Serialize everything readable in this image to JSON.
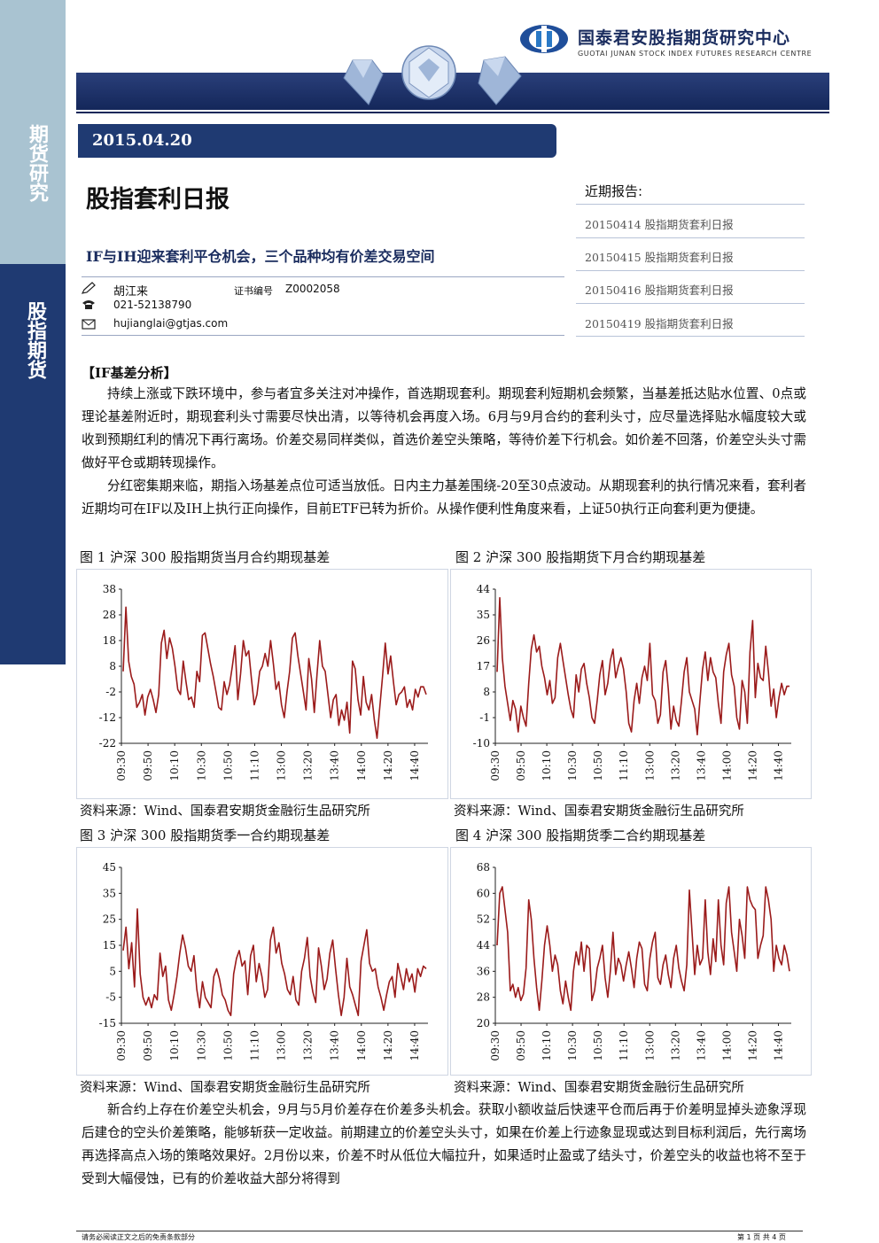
{
  "sidebar": {
    "label_1": "期货研究",
    "label_2": "股指期货"
  },
  "header": {
    "company_cn": "国泰君安股指期货研究中心",
    "company_en": "GUOTAI JUNAN STOCK INDEX FUTURES RESEARCH CENTRE"
  },
  "date": "2015.04.20",
  "report_title": "股指套利日报",
  "headline": "IF与IH迎来套利平仓机会，三个品种均有价差交易空间",
  "author": {
    "name": "胡江来",
    "license_label": "证书编号",
    "license_no": "Z0002058",
    "phone": "021-52138790",
    "email": "hujianglai@gtjas.com"
  },
  "recent": {
    "title": "近期报告:",
    "items": [
      "20150414 股指期货套利日报",
      "20150415 股指期货套利日报",
      "20150416 股指期货套利日报",
      "20150419 股指期货套利日报"
    ]
  },
  "section_title": "【IF基差分析】",
  "paragraphs": [
    "持续上涨或下跌环境中，参与者宜多关注对冲操作，首选期现套利。期现套利短期机会频繁，当基差抵达贴水位置、0点或理论基差附近时，期现套利头寸需要尽快出清，以等待机会再度入场。6月与9月合约的套利头寸，应尽量选择贴水幅度较大或收到预期红利的情况下再行离场。价差交易同样类似，首选价差空头策略，等待价差下行机会。如价差不回落，价差空头头寸需做好平仓或期转现操作。",
    "分红密集期来临，期指入场基差点位可适当放低。日内主力基差围绕-20至30点波动。从期现套利的执行情况来看，套利者近期均可在IF以及IH上执行正向操作，目前ETF已转为折价。从操作便利性角度来看，上证50执行正向套利更为便捷。",
    "新合约上存在价差空头机会，9月与5月价差存在价差多头机会。获取小额收益后快速平仓而后再于价差明显掉头迹象浮现后建仓的空头价差策略，能够斩获一定收益。前期建立的价差空头头寸，如果在价差上行迹象显现或达到目标利润后，先行离场再选择高点入场的策略效果好。2月份以来，价差不时从低位大幅拉升，如果适时止盈或了结头寸，价差空头的收益也将不至于受到大幅侵蚀，已有的价差收益大部分将得到"
  ],
  "source_text": "资料来源：Wind、国泰君安期货金融衍生品研究所",
  "footer": {
    "left": "请务必阅读正文之后的免责条款部分",
    "right": "第 1 页 共 4 页"
  },
  "colors": {
    "navy": "#1f3a72",
    "line": "#9b1b1b",
    "sidebar_light": "#a9c3d1"
  },
  "chart_data": [
    {
      "type": "line",
      "title": "图 1 沪深 300 股指期货当月合约期现基差",
      "yticks": [
        38,
        28,
        18,
        8,
        -2,
        -12,
        -22
      ],
      "ylim": [
        -22,
        38
      ],
      "x_ticks": [
        "09:30",
        "09:50",
        "10:10",
        "10:30",
        "10:50",
        "11:10",
        "13:00",
        "13:20",
        "13:40",
        "14:00",
        "14:20",
        "14:40"
      ],
      "series": [
        {
          "values": [
            6,
            31,
            10,
            4,
            1,
            -8,
            -6,
            -3,
            -11,
            -4,
            -1,
            -5,
            -10,
            -3,
            17,
            22,
            11,
            19,
            15,
            8,
            -1,
            -3,
            10,
            2,
            -5,
            -4,
            -8,
            6,
            2,
            20,
            21,
            15,
            9,
            4,
            -2,
            -8,
            -9,
            2,
            -3,
            1,
            8,
            16,
            -5,
            5,
            18,
            12,
            14,
            3,
            -7,
            -3,
            6,
            8,
            13,
            8,
            18,
            9,
            -1,
            2,
            -7,
            -12,
            -2,
            6,
            19,
            21,
            12,
            5,
            -2,
            -9,
            11,
            3,
            -10,
            5,
            18,
            8,
            6,
            -3,
            -12,
            -5,
            -3,
            -15,
            -9,
            -13,
            -6,
            -18,
            10,
            7,
            -5,
            -11,
            4,
            -6,
            -9,
            -3,
            -13,
            -20,
            -8,
            4,
            17,
            5,
            12,
            2,
            -7,
            -3,
            -2,
            0,
            -8,
            -5,
            -9,
            -1,
            -4,
            0,
            0,
            -3
          ]
        }
      ]
    },
    {
      "type": "line",
      "title": "图 2 沪深 300 股指期货下月合约期现基差",
      "yticks": [
        44,
        35,
        26,
        17,
        8,
        -1,
        -10
      ],
      "ylim": [
        -10,
        44
      ],
      "x_ticks": [
        "09:30",
        "09:50",
        "10:10",
        "10:30",
        "10:50",
        "11:10",
        "13:00",
        "13:20",
        "13:40",
        "14:00",
        "14:20",
        "14:40"
      ],
      "series": [
        {
          "values": [
            15,
            41,
            20,
            10,
            4,
            -2,
            5,
            2,
            -6,
            3,
            -1,
            -4,
            11,
            23,
            28,
            22,
            24,
            17,
            13,
            7,
            12,
            4,
            6,
            20,
            25,
            19,
            13,
            7,
            2,
            -1,
            14,
            8,
            16,
            18,
            11,
            6,
            -1,
            -3,
            5,
            14,
            19,
            7,
            11,
            19,
            23,
            13,
            17,
            20,
            16,
            8,
            -3,
            -6,
            5,
            11,
            4,
            13,
            17,
            12,
            25,
            7,
            5,
            -3,
            0,
            15,
            19,
            9,
            -5,
            3,
            -2,
            -4,
            5,
            15,
            20,
            8,
            5,
            2,
            -7,
            5,
            16,
            22,
            12,
            20,
            15,
            13,
            4,
            -3,
            15,
            21,
            25,
            14,
            10,
            -1,
            -5,
            12,
            8,
            -3,
            22,
            33,
            6,
            18,
            13,
            12,
            24,
            15,
            3,
            9,
            -1,
            6,
            11,
            7,
            10,
            10
          ]
        }
      ]
    },
    {
      "type": "line",
      "title": "图 3 沪深 300 股指期货季一合约期现基差",
      "yticks": [
        45,
        35,
        25,
        15,
        5,
        -5,
        -15
      ],
      "ylim": [
        -15,
        45
      ],
      "x_ticks": [
        "09:30",
        "09:50",
        "10:10",
        "10:30",
        "10:50",
        "11:10",
        "13:00",
        "13:20",
        "13:40",
        "14:00",
        "14:20",
        "14:40"
      ],
      "series": [
        {
          "values": [
            13,
            22,
            6,
            16,
            -1,
            29,
            4,
            -5,
            -8,
            -5,
            -9,
            -4,
            -6,
            12,
            3,
            7,
            -6,
            -10,
            -4,
            3,
            12,
            19,
            14,
            7,
            5,
            11,
            -2,
            -9,
            1,
            -5,
            -7,
            -9,
            3,
            6,
            2,
            -4,
            -6,
            -10,
            -12,
            4,
            10,
            13,
            7,
            9,
            -4,
            11,
            15,
            1,
            8,
            3,
            -5,
            -2,
            17,
            22,
            12,
            16,
            8,
            4,
            -2,
            -4,
            3,
            -6,
            -8,
            5,
            10,
            18,
            3,
            -3,
            -7,
            14,
            7,
            -2,
            2,
            12,
            17,
            6,
            -4,
            -12,
            -5,
            10,
            -1,
            -4,
            -8,
            -12,
            9,
            15,
            21,
            8,
            5,
            6,
            -1,
            -5,
            -10,
            -4,
            1,
            3,
            -5,
            8,
            3,
            -2,
            6,
            1,
            4,
            -3,
            6,
            3,
            7,
            6
          ]
        }
      ]
    },
    {
      "type": "line",
      "title": "图 4 沪深 300 股指期货季二合约期现基差",
      "yticks": [
        68,
        60,
        52,
        44,
        36,
        28,
        20
      ],
      "ylim": [
        20,
        68
      ],
      "x_ticks": [
        "09:30",
        "09:50",
        "10:10",
        "10:30",
        "10:50",
        "11:10",
        "13:00",
        "13:20",
        "13:40",
        "14:00",
        "14:20",
        "14:40"
      ],
      "series": [
        {
          "values": [
            44,
            60,
            62,
            55,
            48,
            30,
            32,
            28,
            31,
            27,
            29,
            37,
            58,
            52,
            40,
            31,
            24,
            33,
            44,
            50,
            44,
            36,
            41,
            38,
            30,
            26,
            33,
            28,
            24,
            36,
            42,
            38,
            45,
            36,
            44,
            43,
            27,
            30,
            37,
            40,
            44,
            34,
            28,
            36,
            48,
            35,
            40,
            38,
            33,
            38,
            42,
            37,
            31,
            40,
            45,
            43,
            32,
            30,
            40,
            45,
            48,
            34,
            32,
            38,
            41,
            35,
            31,
            40,
            44,
            37,
            33,
            30,
            38,
            61,
            48,
            35,
            44,
            38,
            40,
            58,
            42,
            35,
            46,
            39,
            58,
            44,
            38,
            57,
            62,
            48,
            42,
            36,
            52,
            47,
            40,
            62,
            58,
            56,
            55,
            40,
            44,
            47,
            62,
            58,
            52,
            36,
            44,
            40,
            38,
            44,
            41,
            36
          ]
        }
      ]
    }
  ]
}
